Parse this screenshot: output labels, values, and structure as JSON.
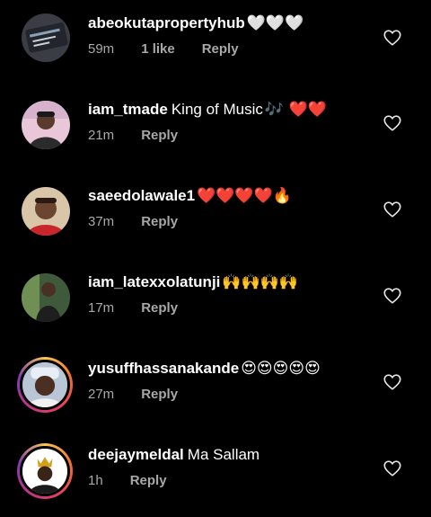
{
  "comments": [
    {
      "username": "abeokutapropertyhub",
      "text": "",
      "emoji": "🤍🤍🤍",
      "time": "59m",
      "likes": "1 like",
      "reply": "Reply",
      "avatar": "property-logo"
    },
    {
      "username": "iam_tmade",
      "text": "King of Music",
      "emoji": "🎶 ❤️❤️",
      "time": "21m",
      "likes": "",
      "reply": "Reply",
      "avatar": "person-photo"
    },
    {
      "username": "saeedolawale1",
      "text": "",
      "emoji": "❤️❤️❤️❤️🔥",
      "time": "37m",
      "likes": "",
      "reply": "Reply",
      "avatar": "person-photo"
    },
    {
      "username": "iam_latexxolatunji",
      "text": "",
      "emoji": "🙌🙌🙌🙌",
      "time": "17m",
      "likes": "",
      "reply": "Reply",
      "avatar": "person-photo"
    },
    {
      "username": "yusuffhassanakande",
      "text": "",
      "emoji": "😍😍😍😍😍",
      "time": "27m",
      "likes": "",
      "reply": "Reply",
      "avatar": "person-photo"
    },
    {
      "username": "deejaymeldal",
      "text": "Ma Sallam",
      "emoji": "",
      "time": "1h",
      "likes": "",
      "reply": "Reply",
      "avatar": "logo"
    }
  ],
  "icons": {
    "like": "heart-outline-icon"
  },
  "colors": {
    "background": "#000000",
    "secondary_text": "#a8a8a8"
  }
}
